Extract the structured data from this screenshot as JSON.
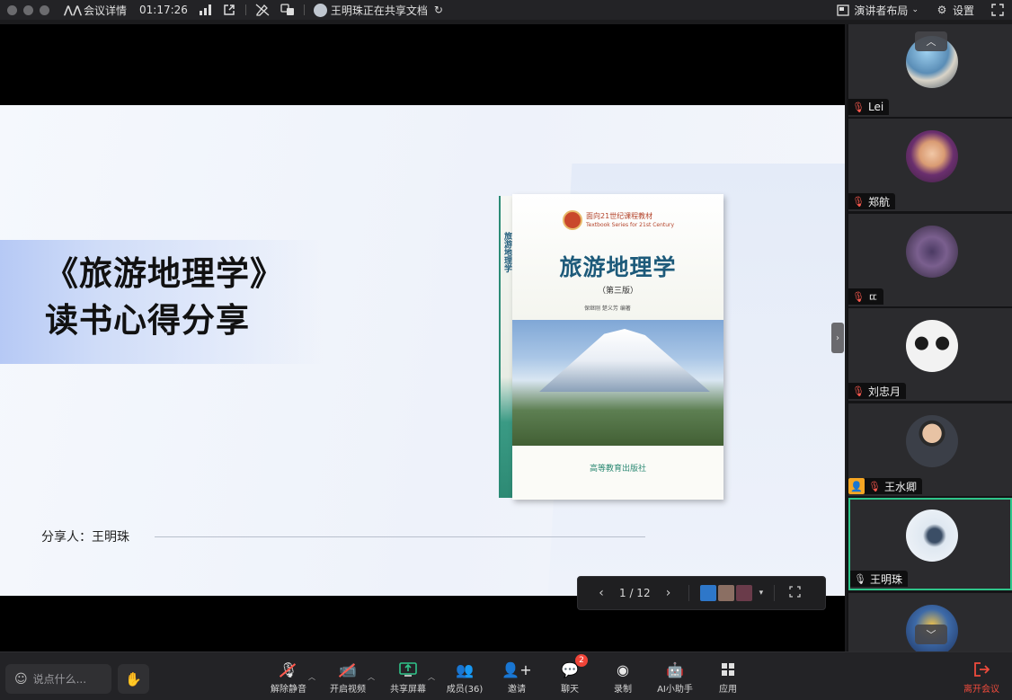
{
  "topbar": {
    "meeting_details": "会议详情",
    "timer": "01:17:26",
    "sharing_status": "王明珠正在共享文档",
    "layout_label": "演讲者布局",
    "settings_label": "设置"
  },
  "slide": {
    "title_line1": "《旅游地理学》",
    "title_line2": "读书心得分享",
    "presenter_line": "分享人：王明珠"
  },
  "book": {
    "series": "面向21世纪课程教材",
    "series_en": "Textbook Series for 21st Century",
    "title": "旅游地理学",
    "edition": "（第三版）",
    "authors": "保继刚 楚义芳 编著",
    "publisher": "高等教育出版社",
    "spine_title": "旅游地理学"
  },
  "page_control": {
    "indicator": "1 / 12"
  },
  "participants": [
    {
      "name": "Lei",
      "mic": "muted",
      "active": false
    },
    {
      "name": "郑航",
      "mic": "muted",
      "active": false
    },
    {
      "name": "ㄸ",
      "mic": "muted",
      "active": false
    },
    {
      "name": "刘忠月",
      "mic": "muted",
      "active": false
    },
    {
      "name": "王水卿",
      "mic": "muted",
      "host": true,
      "active": false
    },
    {
      "name": "王明珠",
      "mic": "on",
      "active": true
    }
  ],
  "toolbar": {
    "chat_placeholder": "说点什么...",
    "unmute": "解除静音",
    "start_video": "开启视频",
    "share_screen": "共享屏幕",
    "members": "成员(36)",
    "invite": "邀请",
    "chat": "聊天",
    "chat_badge": "2",
    "record": "录制",
    "ai_assistant": "AI小助手",
    "apps": "应用",
    "leave": "离开会议"
  },
  "colors": {
    "active_border": "#2fc58a",
    "muted_mic": "#ff5a4f",
    "leave": "#ef4b3c",
    "host_badge": "#f5a623"
  }
}
